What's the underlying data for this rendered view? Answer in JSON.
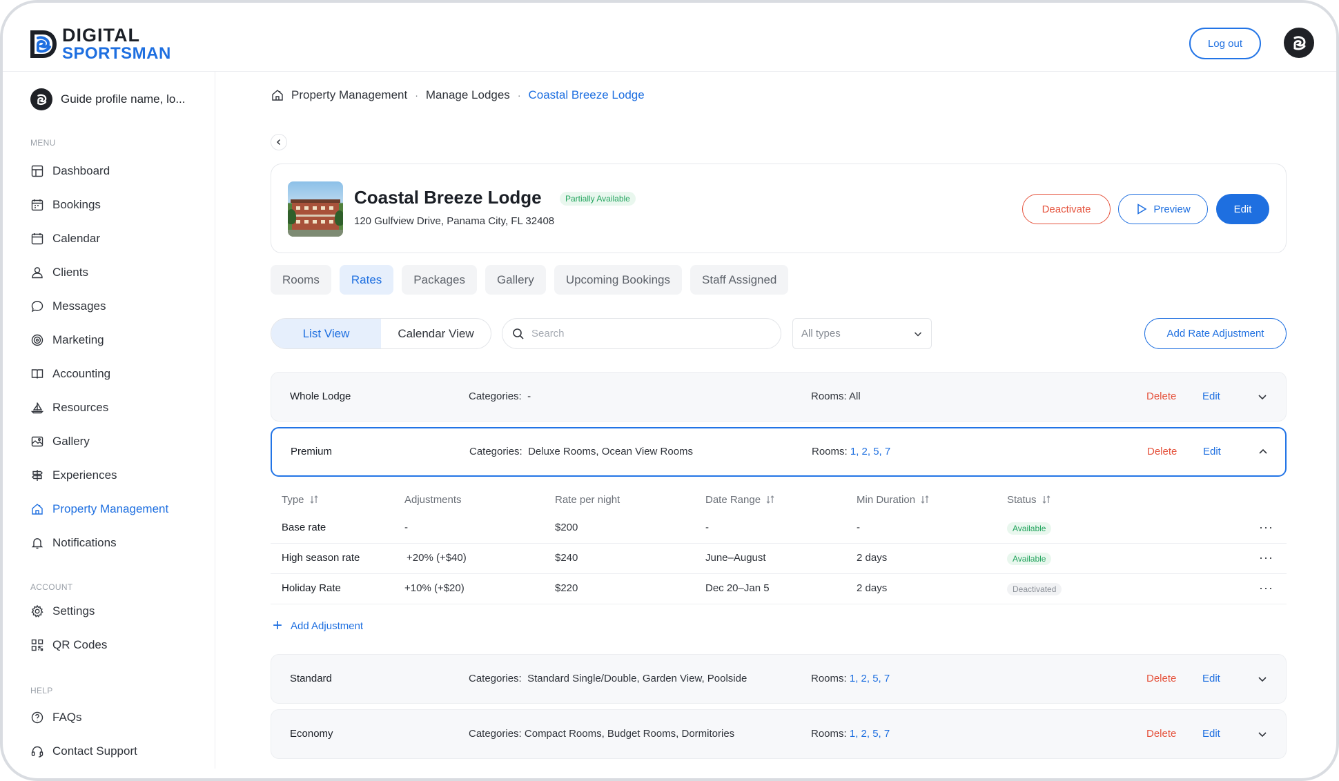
{
  "brand": {
    "line1": "DIGITAL",
    "line2": "SPORTSMAN"
  },
  "header": {
    "logout_label": "Log out"
  },
  "sidebar": {
    "profile_name": "Guide profile name, lo...",
    "menu_label": "MENU",
    "menu_items": [
      {
        "label": "Dashboard",
        "icon": "dashboard-icon"
      },
      {
        "label": "Bookings",
        "icon": "bookings-icon"
      },
      {
        "label": "Calendar",
        "icon": "calendar-icon"
      },
      {
        "label": "Clients",
        "icon": "clients-icon"
      },
      {
        "label": "Messages",
        "icon": "messages-icon"
      },
      {
        "label": "Marketing",
        "icon": "marketing-icon"
      },
      {
        "label": "Accounting",
        "icon": "accounting-icon"
      },
      {
        "label": "Resources",
        "icon": "resources-icon"
      },
      {
        "label": "Gallery",
        "icon": "gallery-icon"
      },
      {
        "label": "Experiences",
        "icon": "experiences-icon"
      },
      {
        "label": "Property Management",
        "icon": "property-management-icon",
        "active": true
      },
      {
        "label": "Notifications",
        "icon": "bell-icon"
      }
    ],
    "account_label": "ACCOUNT",
    "account_items": [
      {
        "label": "Settings",
        "icon": "gear-icon"
      },
      {
        "label": "QR Codes",
        "icon": "qr-code-icon"
      }
    ],
    "help_label": "HELP",
    "help_items": [
      {
        "label": "FAQs",
        "icon": "question-icon"
      },
      {
        "label": "Contact Support",
        "icon": "headset-icon"
      }
    ]
  },
  "breadcrumb": {
    "items": [
      "Property Management",
      "Manage Lodges"
    ],
    "current": "Coastal Breeze Lodge",
    "separator": "·"
  },
  "lodge": {
    "name": "Coastal Breeze Lodge",
    "status": "Partially Available",
    "address": "120 Gulfview Drive, Panama City, FL 32408",
    "deactivate_label": "Deactivate",
    "preview_label": "Preview",
    "edit_label": "Edit"
  },
  "tabs": [
    {
      "label": "Rooms"
    },
    {
      "label": "Rates",
      "active": true
    },
    {
      "label": "Packages"
    },
    {
      "label": "Gallery"
    },
    {
      "label": "Upcoming Bookings"
    },
    {
      "label": "Staff Assigned"
    }
  ],
  "toolbar": {
    "list_view": "List View",
    "calendar_view": "Calendar View",
    "search_placeholder": "Search",
    "type_filter": "All types",
    "add_rate_label": "Add Rate Adjustment"
  },
  "rate_groups": [
    {
      "name": "Whole Lodge",
      "categories_label": "Categories:",
      "categories": "-",
      "rooms_label": "Rooms:",
      "rooms": "All",
      "rooms_linked": false,
      "delete": "Delete",
      "edit": "Edit",
      "expanded": false
    },
    {
      "name": "Premium",
      "categories_label": "Categories:",
      "categories": "Deluxe Rooms, Ocean View Rooms",
      "rooms_label": "Rooms:",
      "rooms": "1, 2, 5, 7",
      "rooms_linked": true,
      "delete": "Delete",
      "edit": "Edit",
      "expanded": true
    },
    {
      "name": "Standard",
      "categories_label": "Categories:",
      "categories": "Standard Single/Double, Garden View, Poolside",
      "rooms_label": "Rooms:",
      "rooms": "1, 2, 5, 7",
      "rooms_linked": true,
      "delete": "Delete",
      "edit": "Edit",
      "expanded": false
    },
    {
      "name": "Economy",
      "categories_label": "Categories:",
      "categories": "Compact Rooms, Budget Rooms, Dormitories",
      "rooms_label": "Rooms:",
      "rooms": "1, 2, 5, 7",
      "rooms_linked": true,
      "delete": "Delete",
      "edit": "Edit",
      "expanded": false
    }
  ],
  "adjustments": {
    "columns": [
      "Type",
      "Adjustments",
      "Rate per night",
      "Date Range",
      "Min Duration",
      "Status"
    ],
    "rows": [
      {
        "type": "Base rate",
        "adjustment": "-",
        "rate": "$200",
        "date_range": "-",
        "min_duration": "-",
        "status": "Available"
      },
      {
        "type": "High season rate",
        "adjustment": "+20% (+$40)",
        "rate": "$240",
        "date_range": "June–August",
        "min_duration": "2 days",
        "status": "Available"
      },
      {
        "type": "Holiday Rate",
        "adjustment": "+10% (+$20)",
        "rate": "$220",
        "date_range": "Dec 20–Jan 5",
        "min_duration": "2 days",
        "status": "Deactivated"
      }
    ],
    "more_label": "···",
    "add_label": "Add Adjustment"
  },
  "colors": {
    "accent": "#1e6fe0",
    "danger": "#e5533d",
    "success": "#22a45d"
  }
}
